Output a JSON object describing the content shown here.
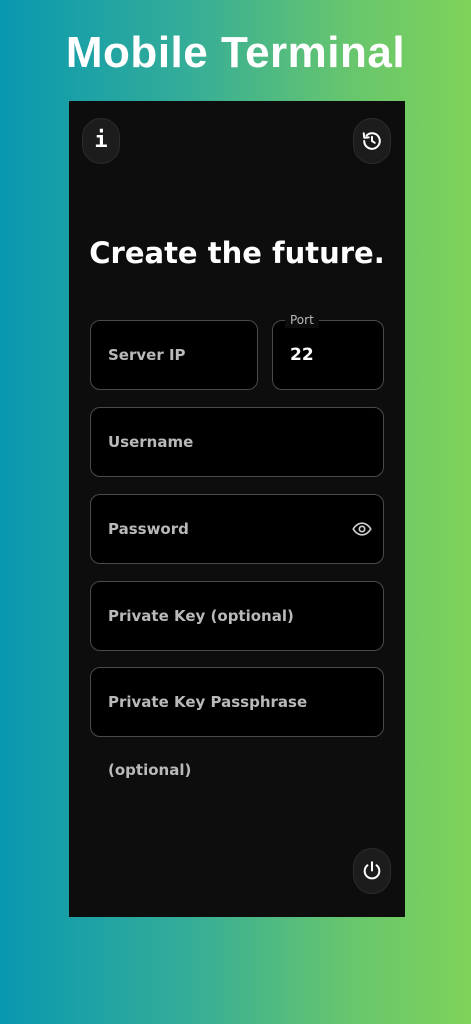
{
  "banner": {
    "title": "Mobile Terminal"
  },
  "header": {
    "info_icon": "info-icon",
    "info_glyph": "i",
    "history_icon": "history-icon"
  },
  "headline": "Create the future.",
  "form": {
    "server_ip": {
      "placeholder": "Server IP",
      "value": ""
    },
    "port": {
      "label": "Port",
      "value": "22"
    },
    "username": {
      "placeholder": "Username",
      "value": ""
    },
    "password": {
      "placeholder": "Password",
      "value": "",
      "toggle_icon": "eye-icon"
    },
    "private_key": {
      "placeholder": "Private Key (optional)",
      "value": ""
    },
    "private_key_passphrase": {
      "placeholder": "Private Key Passphrase (optional)",
      "value": ""
    }
  },
  "footer": {
    "connect_icon": "power-icon"
  },
  "colors": {
    "gradient_start": "#0898b0",
    "gradient_end": "#7fd35a",
    "panel_background": "#0d0d0d",
    "field_background": "#000000",
    "field_border": "#4a4a4a",
    "text_primary": "#ffffff",
    "text_secondary": "#b9b9b9"
  }
}
